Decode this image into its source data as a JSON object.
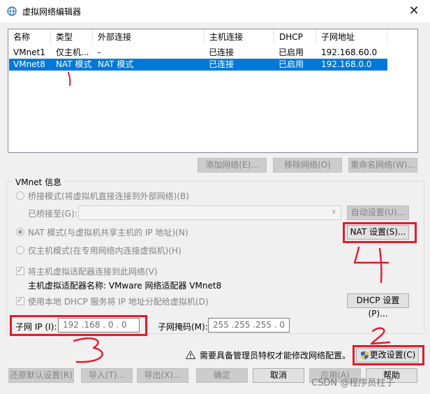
{
  "window": {
    "title": "虚拟网络编辑器",
    "close_label": "✕"
  },
  "table": {
    "headers": [
      "名称",
      "类型",
      "外部连接",
      "主机连接",
      "DHCP",
      "子网地址"
    ],
    "rows": [
      [
        "VMnet1",
        "仅主机...",
        "-",
        "已连接",
        "已启用",
        "192.168.60.0"
      ],
      [
        "VMnet8",
        "NAT 模式",
        "NAT 模式",
        "已连接",
        "已启用",
        "192.168.0.0"
      ]
    ],
    "selected_row": 1
  },
  "table_buttons": {
    "add": "添加网络(E)...",
    "remove": "移除网络(O)",
    "rename": "重命名网络(W)..."
  },
  "vmnet_info": {
    "group_label": "VMnet 信息",
    "bridge_mode": "桥接模式(将虚拟机直接连接到外部网络)(B)",
    "bridged_to_label": "已桥接至(G):",
    "bridged_to_value": "",
    "auto_settings": "自动设置(U)...",
    "nat_mode": "NAT 模式(与虚拟机共享主机的 IP 地址)(N)",
    "nat_settings": "NAT 设置(S)...",
    "host_only_mode": "仅主机模式(在专用网络内连接虚拟机)(H)",
    "connect_adapter": "将主机虚拟适配器连接到此网络(V)",
    "adapter_name_label": "主机虚拟适配器名称: VMware 网络适配器 VMnet8",
    "use_dhcp": "使用本地 DHCP 服务将 IP 地址分配给虚拟机(D)",
    "dhcp_settings": "DHCP 设置(P)...",
    "subnet_ip_label": "子网 IP (I):",
    "subnet_ip_value": "192 .168 . 0  . 0",
    "subnet_mask_label": "子网掩码(M):",
    "subnet_mask_value": "255 .255 .255 . 0"
  },
  "admin_notice": "需要具备管理员特权才能修改网络配置。",
  "footer_buttons": {
    "change_settings": "更改设置(C)",
    "restore_defaults": "还原默认设置(R)",
    "import": "导入(T)...",
    "export": "导出(X)...",
    "ok": "确定",
    "cancel": "取消",
    "apply": "应用(A)",
    "help": "帮助"
  },
  "annotations": {
    "mark_1": "1",
    "mark_2": "2",
    "mark_3": "3",
    "mark_4": "4"
  },
  "watermark": "CSDN @程序员柱子",
  "colors": {
    "selection": "#0078d7",
    "annotation_red": "#e8182b"
  },
  "icon_names": [
    "network-globe-icon",
    "warning-icon",
    "uac-shield-icon",
    "close-icon"
  ]
}
